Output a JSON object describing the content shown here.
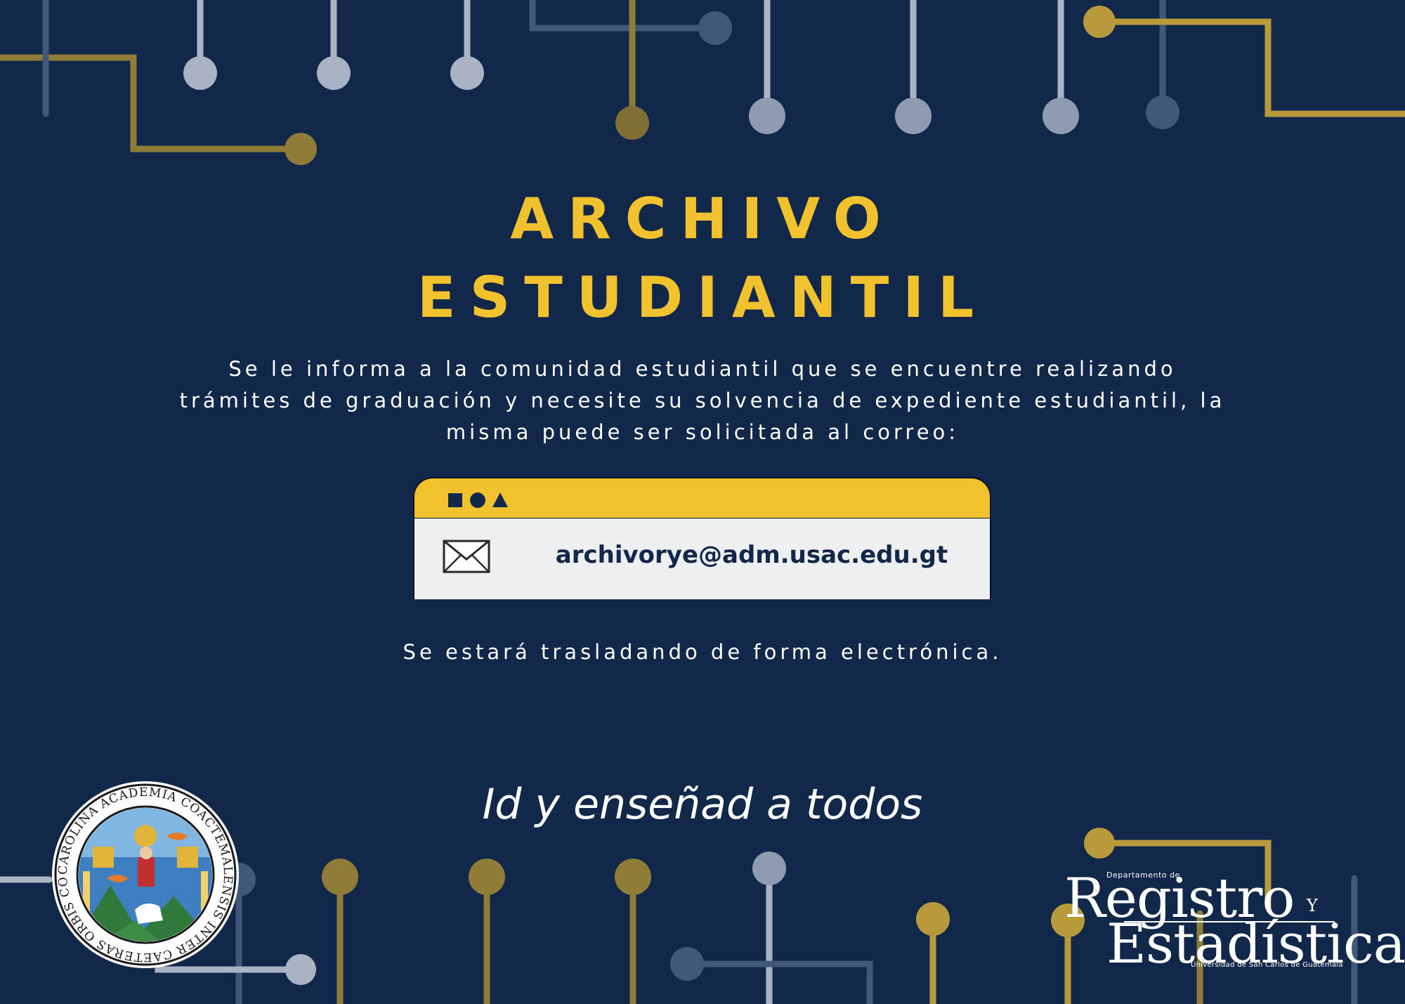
{
  "title": {
    "line1": "ARCHIVO",
    "line2": "ESTUDIANTIL"
  },
  "message": "Se le informa a la comunidad estudiantil que se encuentre realizando trámites de graduación y necesite su solvencia de expediente estudiantil, la misma puede ser solicitada al correo:",
  "email_window": {
    "email": "archivorye@adm.usac.edu.gt",
    "icon": "envelope-icon",
    "controls": [
      "square-icon",
      "circle-icon",
      "triangle-icon"
    ]
  },
  "note": "Se estará trasladando de forma electrónica.",
  "motto": "Id y enseñad a todos",
  "seal": {
    "text": "CAROLINA ACADEMIA COACTEMALENSIS INTER CAETERAS ORBIS CONSPICUA"
  },
  "dept_logo": {
    "top_small": "Departamento de",
    "registro": "Registro",
    "y": "Y",
    "estadistica": "Estadística",
    "subtitle": "Universidad de San Carlos de Guatemala"
  },
  "colors": {
    "background": "#12284a",
    "accent_gold": "#f2c12e",
    "line_gold": "#b89a3a",
    "line_grey": "#aab3c4",
    "text": "#ffffff"
  }
}
